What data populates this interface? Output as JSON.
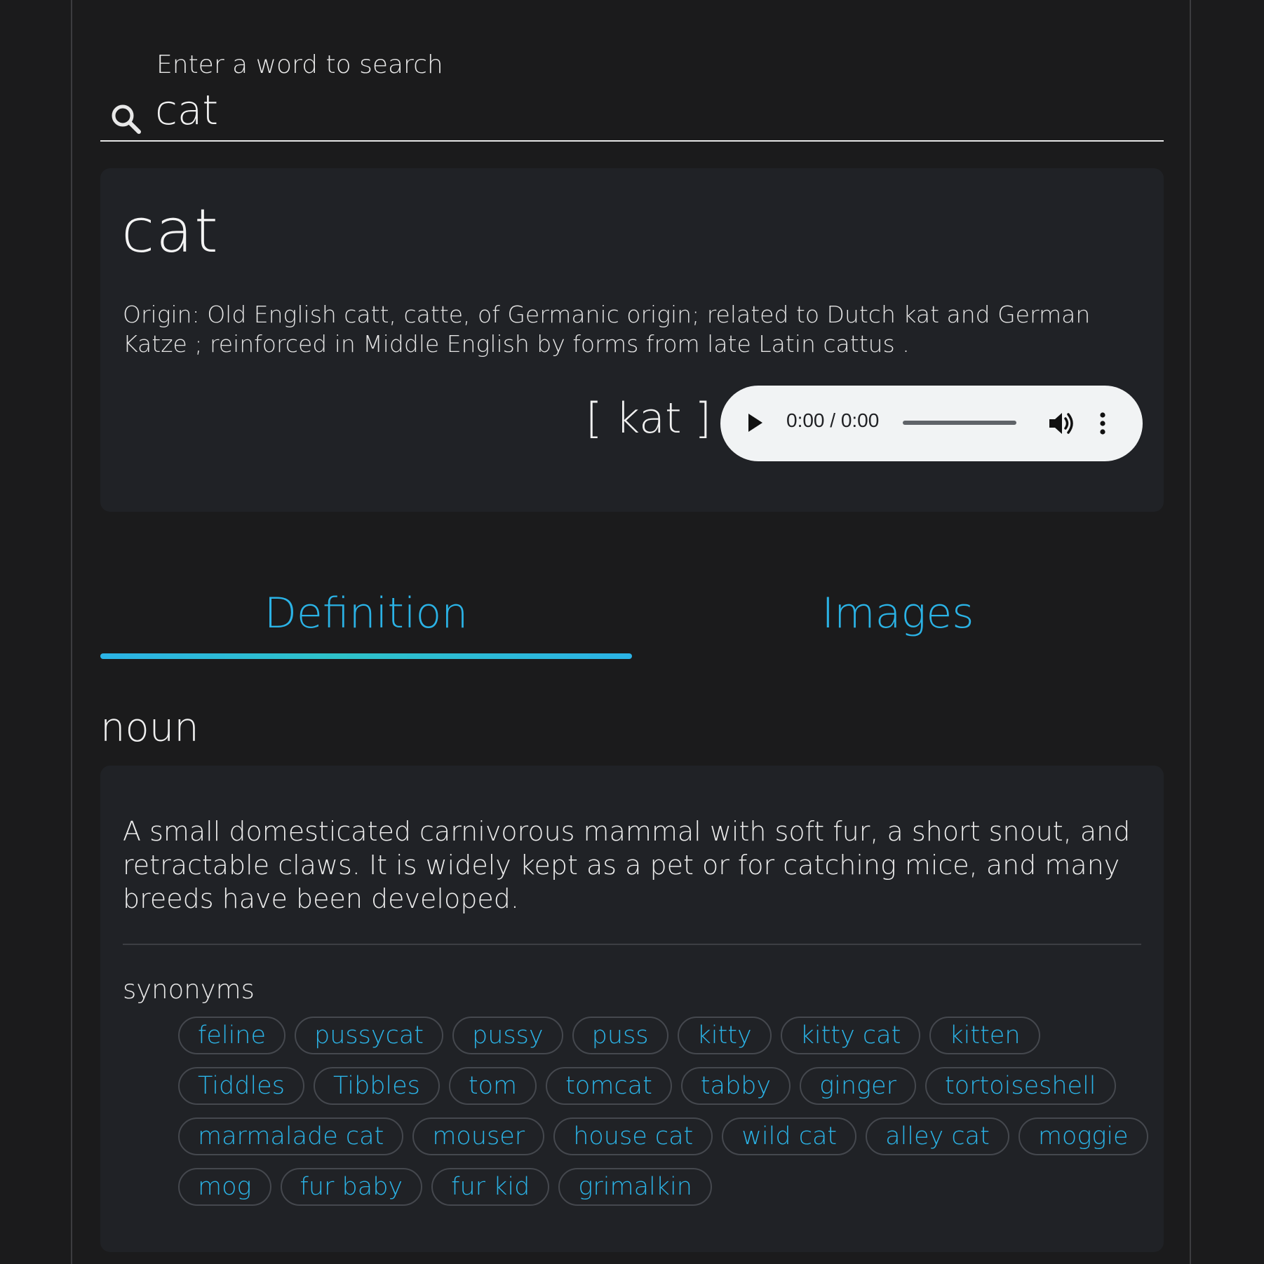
{
  "search": {
    "label": "Enter a word to search",
    "value": "cat"
  },
  "word": {
    "title": "cat",
    "origin": "Origin: Old English catt, catte, of Germanic origin; related to Dutch kat and German Katze ; reinforced in Middle English by forms from late Latin cattus .",
    "phonetic": "[ kat ]",
    "audio": {
      "time": "0:00 / 0:00",
      "progress": 0
    }
  },
  "tabs": [
    {
      "label": "Definition",
      "active": true
    },
    {
      "label": "Images",
      "active": false
    }
  ],
  "meaning": {
    "part_of_speech": "noun",
    "definition": "A small domesticated carnivorous mammal with soft fur, a short snout, and retractable claws. It is widely kept as a pet or for catching mice, and many breeds have been developed.",
    "synonyms_label": "synonyms",
    "synonyms": [
      "feline",
      "pussycat",
      "pussy",
      "puss",
      "kitty",
      "kitty cat",
      "kitten",
      "Tiddles",
      "Tibbles",
      "tom",
      "tomcat",
      "tabby",
      "ginger",
      "tortoiseshell",
      "marmalade cat",
      "mouser",
      "house cat",
      "wild cat",
      "alley cat",
      "moggie",
      "mog",
      "fur baby",
      "fur kid",
      "grimalkin"
    ]
  },
  "colors": {
    "background": "#1b1b1c",
    "card": "#202226",
    "accent": "#2bb3e6",
    "audio_player": "#f1f3f4"
  },
  "icons": {
    "search": "search-icon",
    "play": "play-icon",
    "volume": "volume-icon",
    "more": "more-vertical-icon"
  }
}
